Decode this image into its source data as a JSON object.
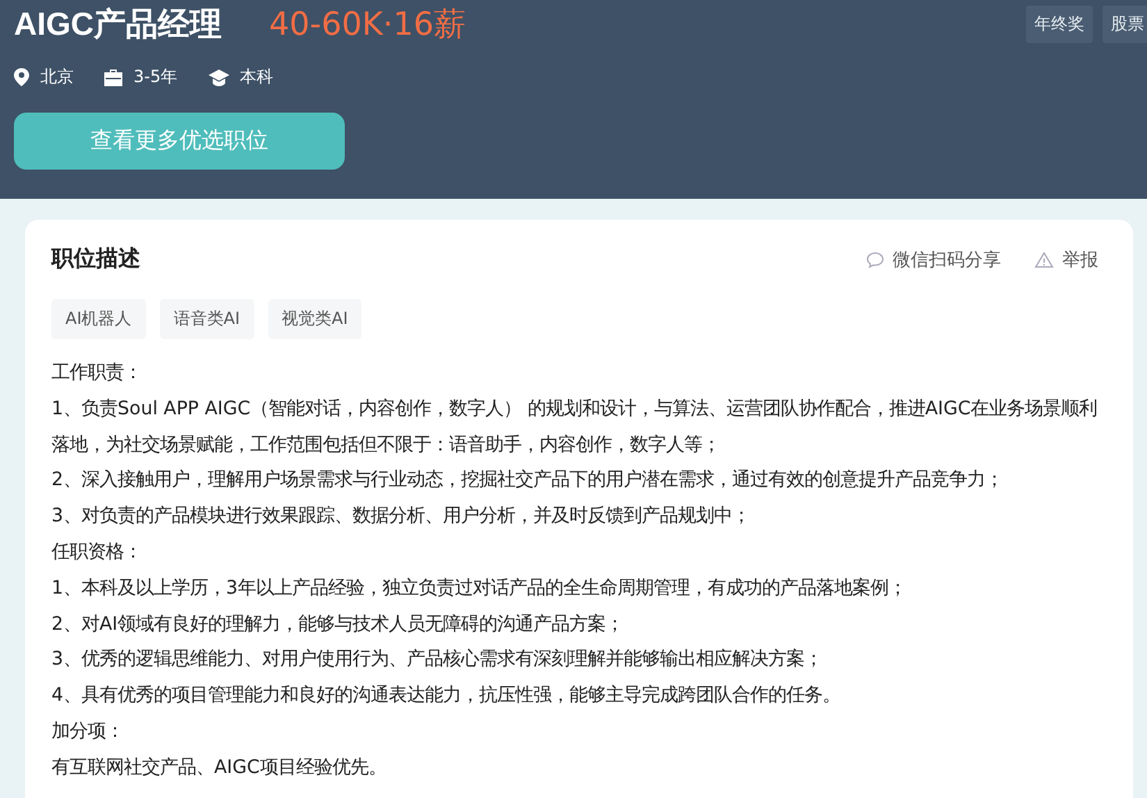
{
  "job": {
    "title": "AIGC产品经理",
    "salary": "40-60K·16薪",
    "benefits": [
      "年终奖",
      "股票"
    ],
    "meta": [
      {
        "kind": "location",
        "text": "北京"
      },
      {
        "kind": "experience",
        "text": "3-5年"
      },
      {
        "kind": "degree",
        "text": "本科"
      }
    ],
    "more_button": "查看更多优选职位"
  },
  "description": {
    "title": "职位描述",
    "share": "微信扫码分享",
    "report": "举报",
    "tags": [
      "AI机器人",
      "语音类AI",
      "视觉类AI"
    ],
    "lines": [
      "工作职责：",
      "1、负责Soul APP AIGC（智能对话，内容创作，数字人） 的规划和设计，与算法、运营团队协作配合，推进AIGC在业务场景顺利落地，为社交场景赋能，工作范围包括但不限于：语音助手，内容创作，数字人等；",
      "2、深入接触用户，理解用户场景需求与行业动态，挖掘社交产品下的用户潜在需求，通过有效的创意提升产品竞争力；",
      "3、对负责的产品模块进行效果跟踪、数据分析、用户分析，并及时反馈到产品规划中；",
      "任职资格：",
      "1、本科及以上学历，3年以上产品经验，独立负责过对话产品的全生命周期管理，有成功的产品落地案例；",
      "2、对AI领域有良好的理解力，能够与技术人员无障碍的沟通产品方案；",
      "3、优秀的逻辑思维能力、对用户使用行为、产品核心需求有深刻理解并能够输出相应解决方案；",
      "4、具有优秀的项目管理能力和良好的沟通表达能力，抗压性强，能够主导完成跨团队合作的任务。",
      "加分项：",
      "有互联网社交产品、AIGC项目经验优先。"
    ]
  }
}
